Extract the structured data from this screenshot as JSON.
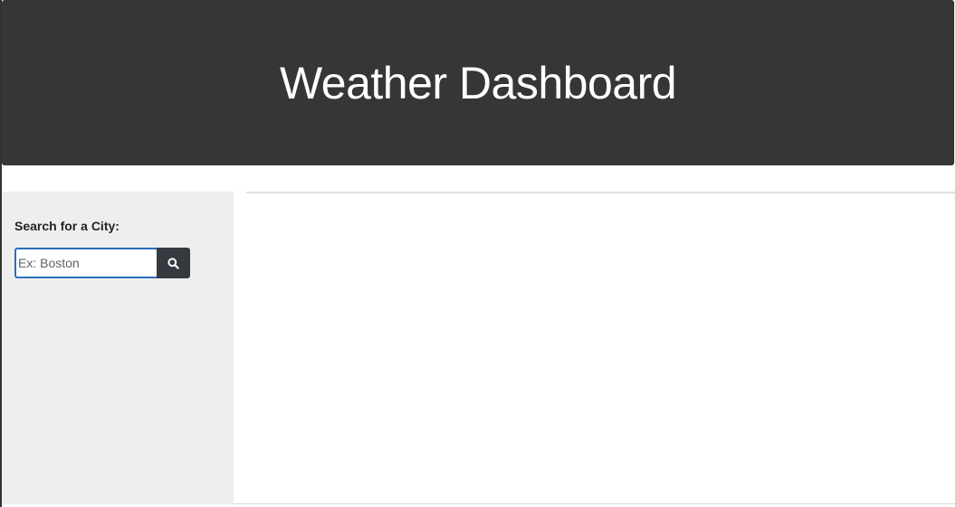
{
  "header": {
    "title": "Weather Dashboard"
  },
  "sidebar": {
    "search_label": "Search for a City:",
    "search_input": {
      "placeholder": "Ex: Boston",
      "value": ""
    },
    "search_button_icon": "search-icon"
  },
  "colors": {
    "header_background": "#363636",
    "sidebar_background": "#eeeeee",
    "button_background": "#343a40",
    "input_focus_border": "#2a6fc0"
  }
}
